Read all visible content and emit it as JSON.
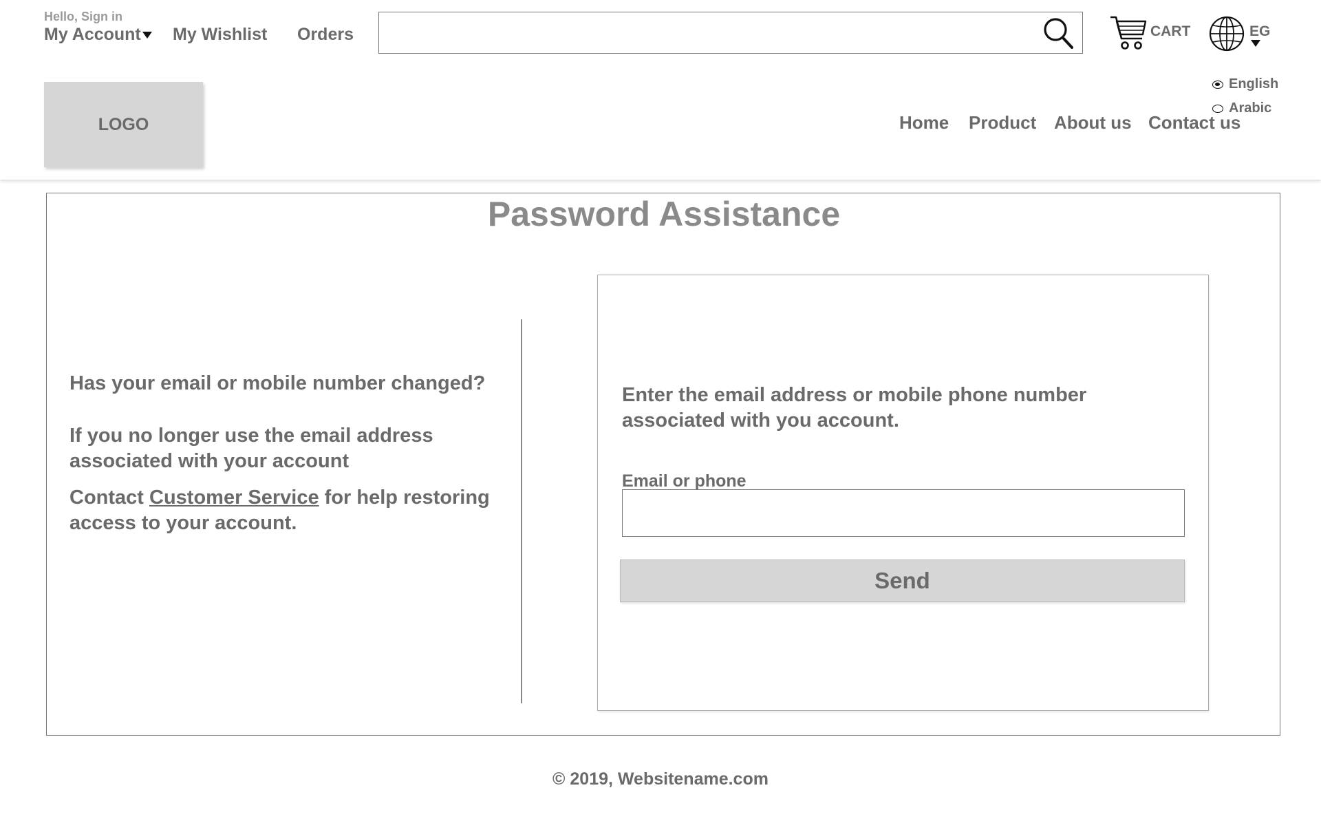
{
  "topbar": {
    "greeting": "Hello, Sign in",
    "account_label": "My Account",
    "wishlist_label": "My Wishlist",
    "orders_label": "Orders",
    "search": {
      "value": "",
      "placeholder": "",
      "icon": "search-icon"
    },
    "cart_label": "CART",
    "region_code": "EG"
  },
  "header": {
    "logo_text": "LOGO",
    "languages": [
      {
        "label": "English",
        "selected": true
      },
      {
        "label": "Arabic",
        "selected": false
      }
    ],
    "nav": [
      "Home",
      "Product",
      "About us",
      "Contact us"
    ]
  },
  "main": {
    "title": "Password Assistance",
    "left": {
      "question": "Has your email or mobile number changed?",
      "no_longer_use": "If you no longer use the email address associated with your account",
      "contact_prefix": "Contact ",
      "contact_link": "Customer Service",
      "contact_suffix": " for help restoring access to your account."
    },
    "form": {
      "intro": "Enter the email address or mobile phone number associated with you account.",
      "field_label": "Email or phone",
      "field_value": "",
      "field_placeholder": "",
      "submit_label": "Send"
    }
  },
  "footer": {
    "copyright": "© 2019, Websitename.com"
  },
  "colors": {
    "text": "#6a6a6a",
    "title": "#8a8a8a",
    "button_bg": "#d6d6d6",
    "logo_bg": "#d6d6d6"
  }
}
